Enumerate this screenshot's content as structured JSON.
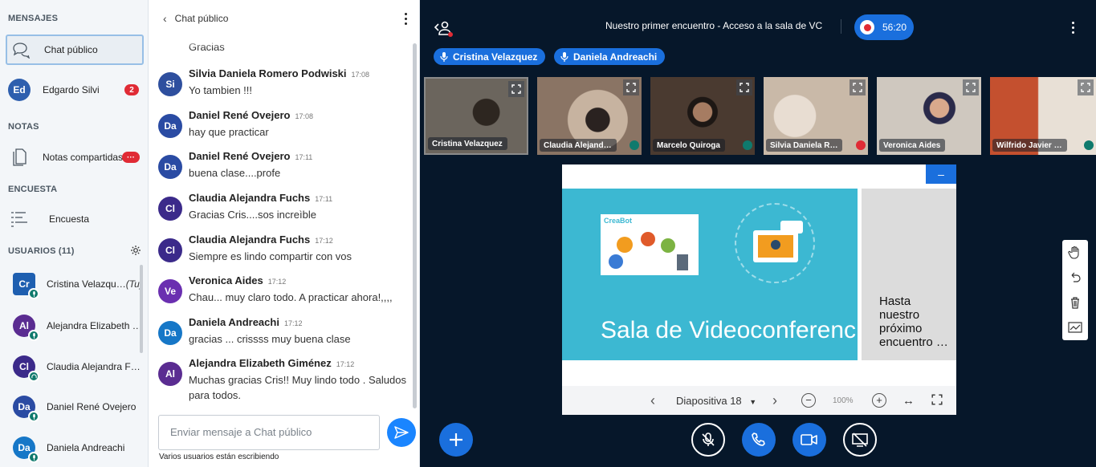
{
  "userlist": {
    "messages_title": "MENSAJES",
    "public_chat_label": "Chat público",
    "private_chat": {
      "initials": "Ed",
      "name": "Edgardo Silvi",
      "unread": "2",
      "color": "#2e5fae"
    },
    "notes_title": "NOTAS",
    "shared_notes_label": "Notas compartidas",
    "shared_notes_badge": "···",
    "poll_title": "ENCUESTA",
    "poll_label": "Encuesta",
    "users_title": "USUARIOS (11)",
    "users": [
      {
        "initials": "Cr",
        "name": "Cristina Velazqu…",
        "you": "(Tu)",
        "color": "#1e5fb0"
      },
      {
        "initials": "Al",
        "name": "Alejandra Elizabeth …",
        "you": "",
        "color": "#5a2c91"
      },
      {
        "initials": "Cl",
        "name": "Claudia Alejandra F…",
        "you": "",
        "color": "#3b2a8a"
      },
      {
        "initials": "Da",
        "name": "Daniel René Ovejero",
        "you": "",
        "color": "#2a4ba3"
      },
      {
        "initials": "Da",
        "name": "Daniela Andreachi",
        "you": "",
        "color": "#1677c7"
      }
    ]
  },
  "chat": {
    "title": "Chat público",
    "first_line": "Gracias",
    "messages": [
      {
        "initials": "Si",
        "name": "Silvia Daniela Romero Podwiski",
        "time": "17:08",
        "text": "Yo tambien !!!",
        "color": "#2e4f9e"
      },
      {
        "initials": "Da",
        "name": "Daniel René Ovejero",
        "time": "17:08",
        "text": "hay que practicar",
        "color": "#2a4ba3"
      },
      {
        "initials": "Da",
        "name": "Daniel René Ovejero",
        "time": "17:11",
        "text": "buena clase....profe",
        "color": "#2a4ba3"
      },
      {
        "initials": "Cl",
        "name": "Claudia Alejandra Fuchs",
        "time": "17:11",
        "text": "Gracias Cris....sos increìble",
        "color": "#3b2a8a"
      },
      {
        "initials": "Cl",
        "name": "Claudia Alejandra Fuchs",
        "time": "17:12",
        "text": "Siempre es lindo compartir con vos",
        "color": "#3b2a8a"
      },
      {
        "initials": "Ve",
        "name": "Veronica Aides",
        "time": "17:12",
        "text": "Chau... muy claro todo. A practicar ahora!,,,,",
        "color": "#6a2fb0"
      },
      {
        "initials": "Da",
        "name": "Daniela Andreachi",
        "time": "17:12",
        "text": "gracias ... crissss muy buena clase",
        "color": "#1677c7"
      },
      {
        "initials": "Al",
        "name": "Alejandra Elizabeth Giménez",
        "time": "17:12",
        "text": "Muchas gracias Cris!! Muy lindo todo . Saludos para todos.",
        "color": "#5a2c91"
      }
    ],
    "input_placeholder": "Enviar mensaje a Chat público",
    "typing_indicator": "Varios usuarios están escribiendo"
  },
  "meeting": {
    "title": "Nuestro primer encuentro - Acceso a la sala de VC",
    "timer": "56:20",
    "talking": [
      "Cristina Velazquez",
      "Daniela Andreachi"
    ],
    "videos": [
      {
        "name": "Cristina Velazquez",
        "bg": "#5a544c"
      },
      {
        "name": "Claudia Alejand…",
        "bg": "#8a7464"
      },
      {
        "name": "Marcelo Quiroga",
        "bg": "#4a3a30"
      },
      {
        "name": "Silvia Daniela R…",
        "bg": "#c9b9a8"
      },
      {
        "name": "Veronica Aides",
        "bg": "#cfc8bf"
      },
      {
        "name": "Wilfrido Javier …",
        "bg": "#b5563a"
      }
    ],
    "slide": {
      "main_text": "Sala de Videoconferenc",
      "side_text": "Hasta nuestro próximo encuentro …",
      "logo_text": "CreaBot",
      "slide_label": "Diapositiva 18",
      "zoom": "100%"
    }
  },
  "colors": {
    "primary": "#1a6fdd",
    "danger": "#e02b35",
    "stage_bg": "#06172a"
  }
}
